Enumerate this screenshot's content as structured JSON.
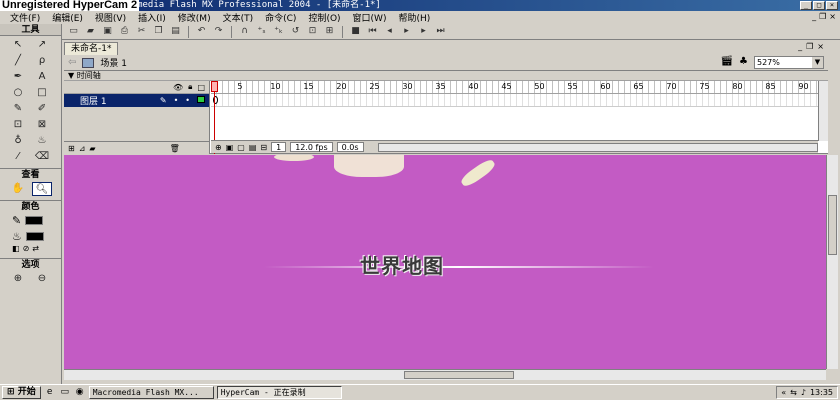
{
  "titlebar": {
    "watermark": "Unregistered HyperCam 2",
    "title": "Macromedia Flash MX Professional 2004 - [未命名-1*]"
  },
  "menu": {
    "items": [
      "文件(F)",
      "编辑(E)",
      "视图(V)",
      "插入(I)",
      "修改(M)",
      "文本(T)",
      "命令(C)",
      "控制(O)",
      "窗口(W)",
      "帮助(H)"
    ]
  },
  "tools": {
    "header": "工具",
    "view_section": "查看",
    "color_section": "颜色",
    "options_section": "选项",
    "icons": [
      "arrow-icon",
      "subselect-icon",
      "line-icon",
      "lasso-icon",
      "pen-icon",
      "text-icon",
      "oval-icon",
      "rectangle-icon",
      "pencil-icon",
      "brush-icon",
      "free-transform-icon",
      "fill-transform-icon",
      "ink-bottle-icon",
      "paint-bucket-icon",
      "eyedropper-icon",
      "eraser-icon"
    ]
  },
  "document": {
    "tab_label": "未命名-1*",
    "scene_label": "场景 1",
    "zoom": "527%"
  },
  "timeline": {
    "header": "时间轴",
    "layer_name": "图层 1",
    "ruler_labels": [
      "1",
      "5",
      "10",
      "15",
      "20",
      "25",
      "30",
      "35",
      "40",
      "45",
      "50",
      "55",
      "60",
      "65",
      "70",
      "75",
      "80",
      "85",
      "90"
    ],
    "current_frame": "1",
    "frame_rate": "12.0 fps",
    "elapsed": "0.0s"
  },
  "stage": {
    "text": "世界地图",
    "background": "#c35bc4"
  },
  "taskbar": {
    "start": "开始",
    "tasks": [
      "Macromedia Flash MX...",
      "HyperCam - 正在录制"
    ],
    "clock": "13:35"
  }
}
